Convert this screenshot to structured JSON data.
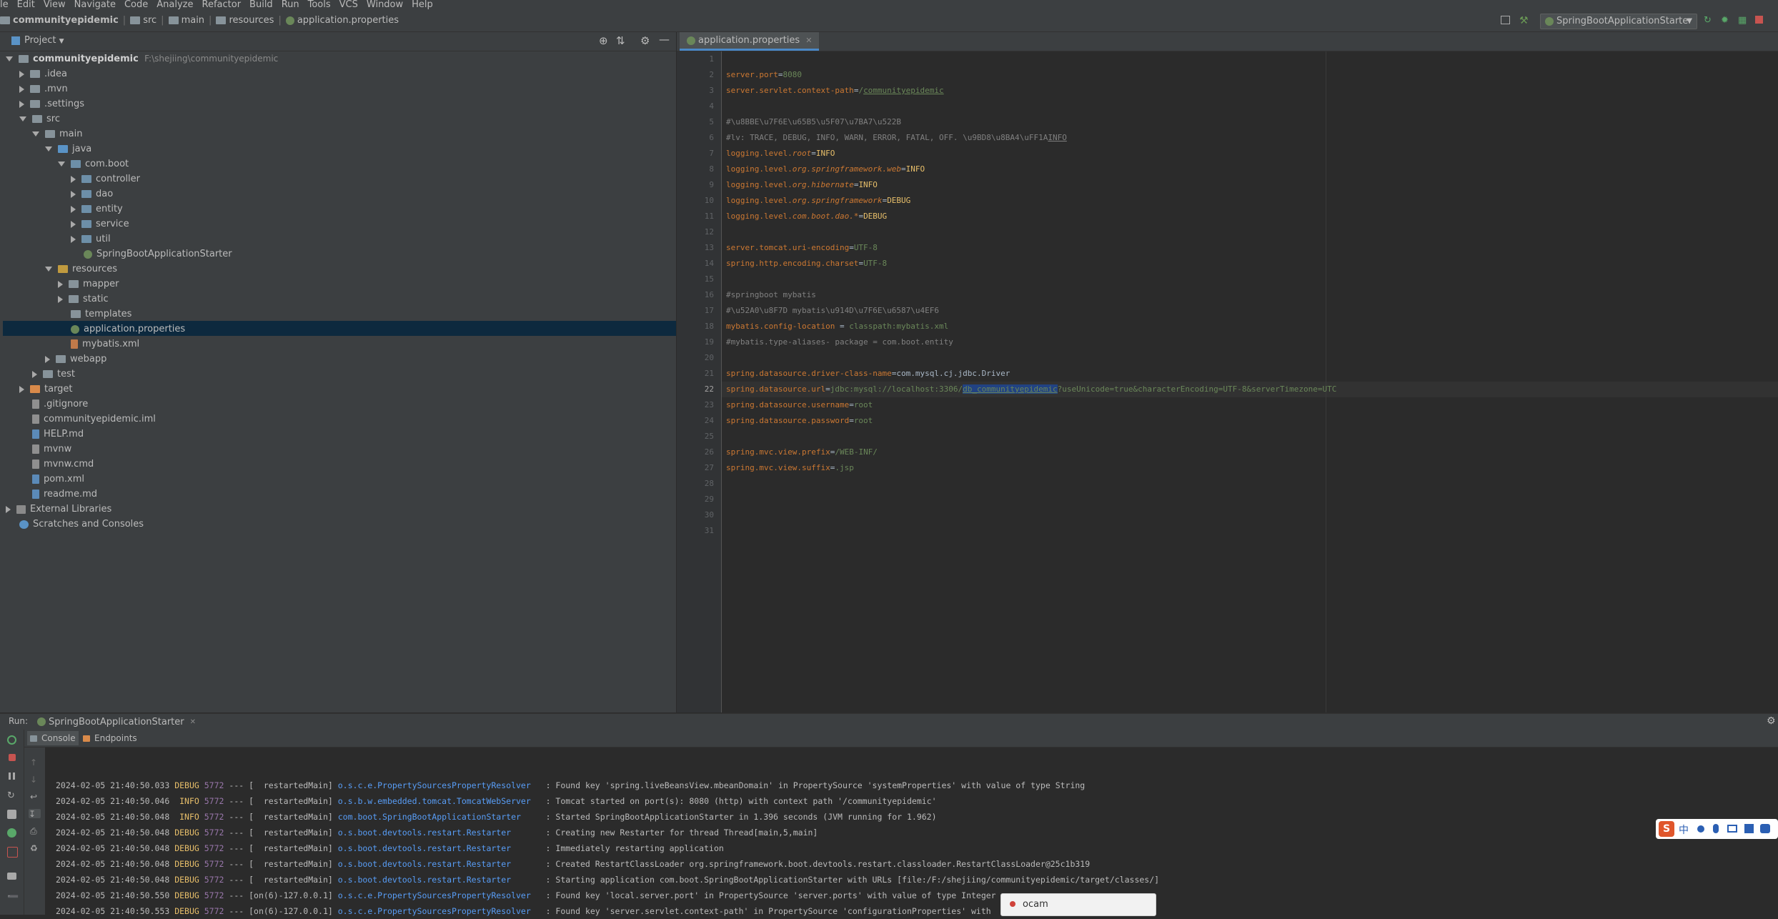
{
  "menu": [
    "le",
    "Edit",
    "View",
    "Navigate",
    "Code",
    "Analyze",
    "Refactor",
    "Build",
    "Run",
    "Tools",
    "VCS",
    "Window",
    "Help"
  ],
  "breadcrumb": {
    "project": "communityepidemic",
    "items": [
      "src",
      "main",
      "resources",
      "application.properties"
    ]
  },
  "run_config": "SpringBootApplicationStarter",
  "project_panel": {
    "title": "Project",
    "tree": [
      {
        "label": "communityepidemic",
        "path": "F:\\shejiing\\communityepidemic"
      },
      {
        "label": ".idea"
      },
      {
        "label": ".mvn"
      },
      {
        "label": ".settings"
      },
      {
        "label": "src"
      },
      {
        "label": "main"
      },
      {
        "label": "java"
      },
      {
        "label": "com.boot"
      },
      {
        "label": "controller"
      },
      {
        "label": "dao"
      },
      {
        "label": "entity"
      },
      {
        "label": "service"
      },
      {
        "label": "util"
      },
      {
        "label": "SpringBootApplicationStarter"
      },
      {
        "label": "resources"
      },
      {
        "label": "mapper"
      },
      {
        "label": "static"
      },
      {
        "label": "templates"
      },
      {
        "label": "application.properties"
      },
      {
        "label": "mybatis.xml"
      },
      {
        "label": "webapp"
      },
      {
        "label": "test"
      },
      {
        "label": "target"
      },
      {
        "label": ".gitignore"
      },
      {
        "label": "communityepidemic.iml"
      },
      {
        "label": "HELP.md"
      },
      {
        "label": "mvnw"
      },
      {
        "label": "mvnw.cmd"
      },
      {
        "label": "pom.xml"
      },
      {
        "label": "readme.md"
      },
      {
        "label": "External Libraries"
      },
      {
        "label": "Scratches and Consoles"
      }
    ]
  },
  "editor": {
    "tab": "application.properties",
    "line_numbers": [
      "1",
      "2",
      "3",
      "4",
      "5",
      "6",
      "7",
      "8",
      "9",
      "10",
      "11",
      "12",
      "13",
      "14",
      "15",
      "16",
      "17",
      "18",
      "19",
      "20",
      "21",
      "22",
      "23",
      "24",
      "25",
      "26",
      "27",
      "28",
      "29",
      "30",
      "31"
    ],
    "lines": {
      "l2a": "server.port",
      "l2b": "=",
      "l2c": "8080",
      "l3a": "server.servlet.context-path",
      "l3b": "=",
      "l3c": "/",
      "l3d": "communityepidemic",
      "l5": "#\\u8BBE\\u7F6E\\u65B5\\u5F07\\u7BA7\\u522B",
      "l6a": "#lv: TRACE, DEBUG, INFO, WARN, ERROR, FATAL, OFF. \\u9BD8\\u8BA4\\uFF1A",
      "l6b": "INFO",
      "l7a": "logging.level.",
      "l7b": "root",
      "l7c": "=",
      "l7d": "INFO",
      "l8a": "logging.level.",
      "l8b": "org.springframework.web",
      "l8c": "=",
      "l8d": "INFO",
      "l9a": "logging.level.",
      "l9b": "org.hibernate",
      "l9c": "=",
      "l9d": "INFO",
      "l10a": "logging.level.",
      "l10b": "org.springframework",
      "l10c": "=",
      "l10d": "DEBUG",
      "l11a": "logging.level.",
      "l11b": "com.boot.dao.*",
      "l11c": "=",
      "l11d": "DEBUG",
      "l13a": "server.tomcat.uri-encoding",
      "l13b": "=",
      "l13c": "UTF-8",
      "l14a": "spring.http.encoding.charset",
      "l14b": "=",
      "l14c": "UTF-8",
      "l16": "#springboot mybatis",
      "l17": "#\\u52A0\\u8F7D mybatis\\u914D\\u7F6E\\u6587\\u4EF6",
      "l18a": "mybatis.config-location ",
      "l18b": "= ",
      "l18c": "classpath:mybatis.xml",
      "l19": "#mybatis.type-aliases- package = com.boot.entity",
      "l21a": "spring.datasource.driver-class-name",
      "l21b": "=",
      "l21c": "com.mysql.cj.jdbc.Driver",
      "l22a": "spring.datasource.url",
      "l22b": "=",
      "l22c": "jdbc:mysql://localhost:3306/",
      "l22d": "db_communityepidemic",
      "l22e": "?useUnicode=true&characterEncoding=UTF-8&serverTimezone=UTC",
      "l23a": "spring.datasource.username",
      "l23b": "=",
      "l23c": "root",
      "l24a": "spring.datasource.password",
      "l24b": "=",
      "l24c": "root",
      "l26a": "spring.mvc.view.prefix",
      "l26b": "=",
      "l26c": "/WEB-INF/",
      "l27a": "spring.mvc.view.suffix",
      "l27b": "=",
      "l27c": ".jsp"
    }
  },
  "run_panel": {
    "label": "Run:",
    "tab": "SpringBootApplicationStarter",
    "subtabs": [
      "Console",
      "Endpoints"
    ],
    "logs": [
      {
        "ts": "2024-02-05 21:40:50.033",
        "lvl": "DEBUG",
        "pid": "5772",
        "sep": "---",
        "thread": "[  restartedMain]",
        "logger": "o.s.c.e.PropertySourcesPropertyResolver",
        "msg": ": Found key 'spring.liveBeansView.mbeanDomain' in PropertySource 'systemProperties' with value of type String"
      },
      {
        "ts": "2024-02-05 21:40:50.046",
        "lvl": " INFO",
        "pid": "5772",
        "sep": "---",
        "thread": "[  restartedMain]",
        "logger": "o.s.b.w.embedded.tomcat.TomcatWebServer",
        "msg": ": Tomcat started on port(s): 8080 (http) with context path '/communityepidemic'"
      },
      {
        "ts": "2024-02-05 21:40:50.048",
        "lvl": " INFO",
        "pid": "5772",
        "sep": "---",
        "thread": "[  restartedMain]",
        "logger": "com.boot.SpringBootApplicationStarter",
        "msg": ": Started SpringBootApplicationStarter in 1.396 seconds (JVM running for 1.962)"
      },
      {
        "ts": "2024-02-05 21:40:50.048",
        "lvl": "DEBUG",
        "pid": "5772",
        "sep": "---",
        "thread": "[  restartedMain]",
        "logger": "o.s.boot.devtools.restart.Restarter",
        "msg": ": Creating new Restarter for thread Thread[main,5,main]"
      },
      {
        "ts": "2024-02-05 21:40:50.048",
        "lvl": "DEBUG",
        "pid": "5772",
        "sep": "---",
        "thread": "[  restartedMain]",
        "logger": "o.s.boot.devtools.restart.Restarter",
        "msg": ": Immediately restarting application"
      },
      {
        "ts": "2024-02-05 21:40:50.048",
        "lvl": "DEBUG",
        "pid": "5772",
        "sep": "---",
        "thread": "[  restartedMain]",
        "logger": "o.s.boot.devtools.restart.Restarter",
        "msg": ": Created RestartClassLoader org.springframework.boot.devtools.restart.classloader.RestartClassLoader@25c1b319"
      },
      {
        "ts": "2024-02-05 21:40:50.048",
        "lvl": "DEBUG",
        "pid": "5772",
        "sep": "---",
        "thread": "[  restartedMain]",
        "logger": "o.s.boot.devtools.restart.Restarter",
        "msg": ": Starting application com.boot.SpringBootApplicationStarter with URLs [file:/F:/shejiing/communityepidemic/target/classes/]"
      },
      {
        "ts": "2024-02-05 21:40:50.550",
        "lvl": "DEBUG",
        "pid": "5772",
        "sep": "---",
        "thread": "[on(6)-127.0.0.1]",
        "logger": "o.s.c.e.PropertySourcesPropertyResolver",
        "msg": ": Found key 'local.server.port' in PropertySource 'server.ports' with value of type Integer"
      },
      {
        "ts": "2024-02-05 21:40:50.553",
        "lvl": "DEBUG",
        "pid": "5772",
        "sep": "---",
        "thread": "[on(6)-127.0.0.1]",
        "logger": "o.s.c.e.PropertySourcesPropertyResolver",
        "msg": ": Found key 'server.servlet.context-path' in PropertySource 'configurationProperties' with"
      }
    ]
  },
  "popup": {
    "text": "ocam"
  },
  "ime": {
    "label": "中"
  },
  "colors": {
    "accent": "#4a88c7",
    "selection": "#0d293e",
    "keyword": "#cc7832",
    "value": "#6a8759",
    "logger": "#589df6"
  }
}
